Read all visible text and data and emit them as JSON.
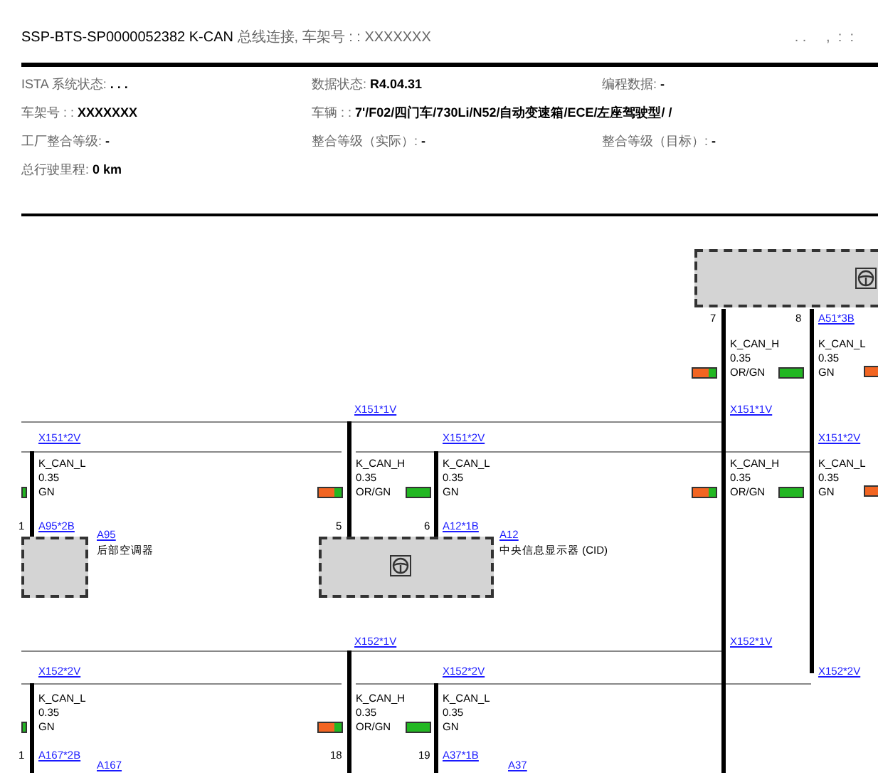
{
  "header": {
    "title": "SSP-BTS-SP0000052382 K-CAN",
    "title_suffix": "总线连接, 车架号 : : XXXXXXX",
    "timestamp": ". .     ,  :  :"
  },
  "info": [
    [
      {
        "label": "ISTA 系统状态:",
        "value": ".  .  ."
      },
      {
        "label": "数据状态:",
        "value": "R4.04.31"
      },
      {
        "label": "编程数据:",
        "value": "-"
      }
    ],
    [
      {
        "label": "车架号 : :",
        "value": "XXXXXXX"
      },
      {
        "label": "车辆 : :",
        "value": "7'/F02/四门车/730Li/N52/自动变速箱/ECE/左座驾驶型/        /"
      }
    ],
    [
      {
        "label": "工厂整合等级:",
        "value": "-"
      },
      {
        "label": "整合等级（实际）:",
        "value": "-"
      },
      {
        "label": "整合等级（目标）:",
        "value": "-"
      }
    ],
    [
      {
        "label": "总行驶里程:",
        "value": "0 km"
      }
    ]
  ],
  "diagram": {
    "modules": [
      {
        "symbol": true
      },
      {
        "symbol": false
      },
      {
        "symbol": true
      }
    ],
    "wires": [
      {
        "signal": "K_CAN_H",
        "gauge": "0.35",
        "color_code": "OR/GN",
        "pin": "7",
        "swatch": [
          {
            "color": "#f26522"
          },
          {
            "color": "#22b722"
          }
        ]
      },
      {
        "signal": "K_CAN_L",
        "gauge": "0.35",
        "color_code": "GN",
        "pin": "8",
        "swatch": [
          {
            "color": "#22b722"
          }
        ]
      },
      {
        "signal": "K_CAN_L",
        "gauge": "0.35",
        "color_code": "GN",
        "pin": "1",
        "swatch": [
          {
            "color": "#22b722"
          }
        ]
      },
      {
        "signal": "K_CAN_H",
        "gauge": "0.35",
        "color_code": "OR/GN",
        "pin": "5",
        "swatch": [
          {
            "color": "#f26522"
          },
          {
            "color": "#22b722"
          }
        ]
      },
      {
        "signal": "K_CAN_L",
        "gauge": "0.35",
        "color_code": "GN",
        "pin": "6",
        "swatch": [
          {
            "color": "#22b722"
          }
        ]
      },
      {
        "signal": "K_CAN_H",
        "gauge": "0.35",
        "color_code": "OR/GN",
        "swatch": [
          {
            "color": "#f26522"
          },
          {
            "color": "#22b722"
          }
        ]
      },
      {
        "signal": "K_CAN_L",
        "gauge": "0.35",
        "color_code": "GN",
        "swatch": [
          {
            "color": "#22b722"
          }
        ]
      },
      {
        "signal": "K_CAN_L",
        "gauge": "0.35",
        "color_code": "GN",
        "pin": "1",
        "swatch": [
          {
            "color": "#22b722"
          }
        ]
      },
      {
        "signal": "K_CAN_H",
        "gauge": "0.35",
        "color_code": "OR/GN",
        "pin": "18",
        "swatch": [
          {
            "color": "#f26522"
          },
          {
            "color": "#22b722"
          }
        ]
      },
      {
        "signal": "K_CAN_L",
        "gauge": "0.35",
        "color_code": "GN",
        "pin": "19",
        "swatch": [
          {
            "color": "#22b722"
          }
        ]
      }
    ],
    "edge_swatches": [
      {
        "color": "#f26522"
      },
      {
        "color": "#f26522"
      }
    ],
    "links": [
      "A51*3B",
      "X151*1V",
      "X151*1V",
      "X151*2V",
      "X151*2V",
      "X151*2V",
      "A95*2B",
      "A12*1B",
      "A95",
      "A12",
      "X152*1V",
      "X152*1V",
      "X152*2V",
      "X152*2V",
      "X152*2V",
      "A167*2B",
      "A37*1B",
      "A167",
      "A37"
    ],
    "descriptions": [
      "后部空调器",
      "中央信息显示器 (CID)"
    ]
  }
}
